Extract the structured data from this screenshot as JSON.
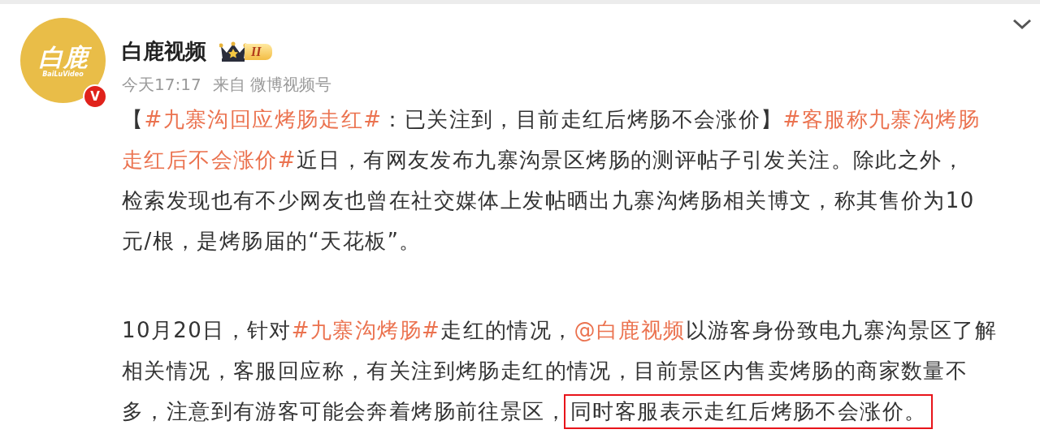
{
  "post": {
    "author": {
      "name": "白鹿视频",
      "avatar_text": "白鹿",
      "avatar_subtext": "BaiLuVideo",
      "verified_mark": "V",
      "level_badge": "II"
    },
    "meta": {
      "time": "今天17:17",
      "source": "来自 微博视频号"
    },
    "paragraphs": [
      [
        [
          {
            "kind": "text",
            "text": "【"
          },
          {
            "kind": "topic",
            "text": "#九寨沟回应烤肠走红#"
          },
          {
            "kind": "text",
            "text": "：已关注到，目前走红后烤肠不会涨价】"
          },
          {
            "kind": "topic",
            "text": "#客服称九寨沟烤肠"
          }
        ],
        [
          {
            "kind": "topic",
            "text": "走红后不会涨价#"
          },
          {
            "kind": "text",
            "text": "近日，有网友发布九寨沟景区烤肠的测评帖子引发关注。除此之外，"
          }
        ],
        [
          {
            "kind": "text",
            "text": "检索发现也有不少网友也曾在社交媒体上发帖晒出九寨沟烤肠相关博文，称其售价为10"
          }
        ],
        [
          {
            "kind": "text",
            "text": "元/根，是烤肠届的“天花板”。"
          }
        ]
      ],
      [
        [
          {
            "kind": "text",
            "text": "10月20日，针对"
          },
          {
            "kind": "topic",
            "text": "#九寨沟烤肠#"
          },
          {
            "kind": "text",
            "text": "走红的情况，"
          },
          {
            "kind": "mention",
            "text": "@白鹿视频"
          },
          {
            "kind": "text",
            "text": " 以游客身份致电九寨沟景区了解"
          }
        ],
        [
          {
            "kind": "text",
            "text": "相关情况，客服回应称，有关注到烤肠走红的情况，目前景区内售卖烤肠的商家数量不"
          }
        ],
        [
          {
            "kind": "text",
            "text": "多，注意到有游客可能会奔着烤肠前往景区，"
          },
          {
            "kind": "boxed",
            "text": "同时客服表示走红后烤肠不会涨价。"
          }
        ]
      ]
    ]
  }
}
